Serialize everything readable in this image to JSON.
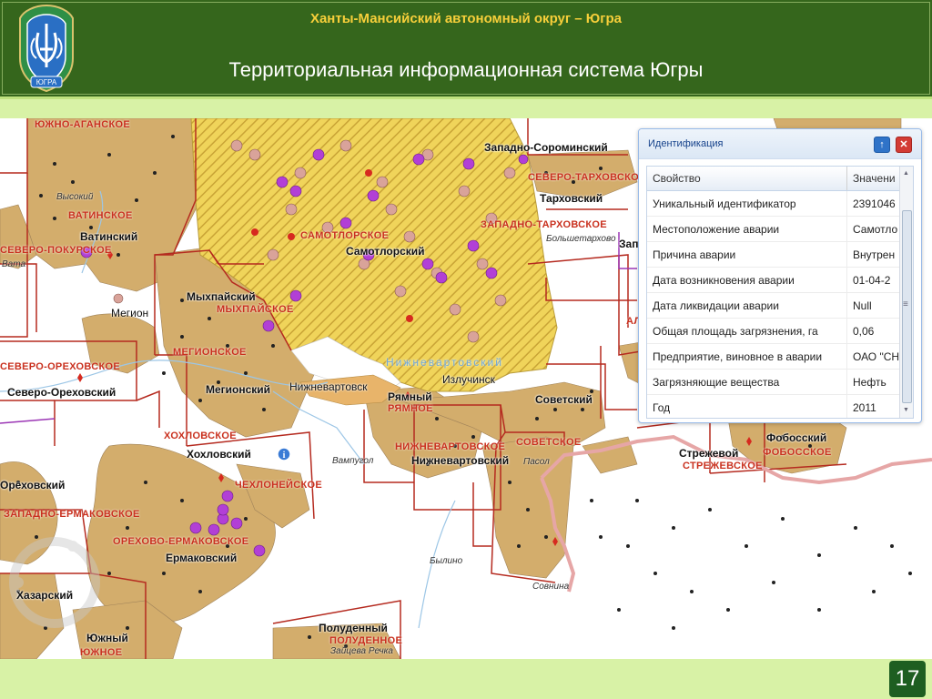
{
  "header": {
    "subtitle": "Ханты-Мансийский автономный округ – Югра",
    "title": "Территориальная информационная система Югры",
    "logo_text": "ЮГРА"
  },
  "map": {
    "places": [
      {
        "id": "vatinsky",
        "text": "Ватинский"
      },
      {
        "id": "megion",
        "text": "Мегион"
      },
      {
        "id": "myhpaysky",
        "text": "Мыхпайский"
      },
      {
        "id": "samotlorsky",
        "text": "Самотлорский"
      },
      {
        "id": "nizhnevartovsk-city",
        "text": "Нижневартовск"
      },
      {
        "id": "severo-orekhovsky",
        "text": "Северо-Ореховский"
      },
      {
        "id": "megionsky",
        "text": "Мегионский"
      },
      {
        "id": "ryamny",
        "text": "Рямный"
      },
      {
        "id": "izluchinsk",
        "text": "Излучинск"
      },
      {
        "id": "sovetsky",
        "text": "Советский"
      },
      {
        "id": "nizhnevartovsky",
        "text": "Нижневартовский"
      },
      {
        "id": "khokhlovsky",
        "text": "Хохловский"
      },
      {
        "id": "orekhovsky",
        "text": "Ореховский"
      },
      {
        "id": "ermakovsky",
        "text": "Ермаковский"
      },
      {
        "id": "khazarsky",
        "text": "Хазарский"
      },
      {
        "id": "yuzhny",
        "text": "Южный"
      },
      {
        "id": "poludenny",
        "text": "Полуденный"
      },
      {
        "id": "strezhevoy",
        "text": "Стрежевой"
      },
      {
        "id": "fobossky",
        "text": "Фобосский"
      },
      {
        "id": "tarkhovsky",
        "text": "Тарховский"
      },
      {
        "id": "zapadno-sorominsky",
        "text": "Западно-Сороминский"
      }
    ],
    "fields": [
      {
        "id": "yuzhno-aganskoe",
        "text": "ЮЖНО-АГАНСКОЕ"
      },
      {
        "id": "vatinskoe",
        "text": "ВАТИНСКОЕ"
      },
      {
        "id": "severo-pokurskoe",
        "text": "СЕВЕРО-ПОКУРСКОЕ"
      },
      {
        "id": "samotlorskoe",
        "text": "САМОТЛОРСКОЕ"
      },
      {
        "id": "myhpayskoe",
        "text": "МЫХПАЙСКОЕ"
      },
      {
        "id": "megionskoe",
        "text": "МЕГИОНСКОЕ"
      },
      {
        "id": "severo-orekhovskoe",
        "text": "СЕВЕРО-ОРЕХОВСКОЕ"
      },
      {
        "id": "khokhlovskoe",
        "text": "ХОХЛОВСКОЕ"
      },
      {
        "id": "chekhloneyskoe",
        "text": "ЧЕХЛОНЕЙСКОЕ"
      },
      {
        "id": "zapadno-ermakovskoe",
        "text": "ЗАПАДНО-ЕРМАКОВСКОЕ"
      },
      {
        "id": "orekhovo-ermakovskoe",
        "text": "ОРЕХОВО-ЕРМАКОВСКОЕ"
      },
      {
        "id": "ryamnoe",
        "text": "РЯМНОЕ"
      },
      {
        "id": "nizhnevartovskoe",
        "text": "НИЖНЕВАРТОВСКОЕ"
      },
      {
        "id": "sovetskoe",
        "text": "СОВЕТСКОЕ"
      },
      {
        "id": "yuzhnoe",
        "text": "ЮЖНОЕ"
      },
      {
        "id": "poludennoe",
        "text": "ПОЛУДЕННОЕ"
      },
      {
        "id": "strezhevskoe",
        "text": "СТРЕЖЕВСКОЕ"
      },
      {
        "id": "fobosskoe",
        "text": "ФОБОССКОЕ"
      },
      {
        "id": "zapadno-tarkhovskoe",
        "text": "ЗАПАДНО-ТАРХОВСКОЕ"
      },
      {
        "id": "severo-tarkhovskoe",
        "text": "СЕВЕРО-ТАРХОВСКОЕ"
      }
    ],
    "rivers": [
      {
        "id": "vysokiy",
        "text": "Высокий"
      },
      {
        "id": "vata",
        "text": "Вата"
      },
      {
        "id": "vampugol",
        "text": "Вампугол"
      },
      {
        "id": "pasol",
        "text": "Пасол"
      },
      {
        "id": "bylino",
        "text": "Былино"
      },
      {
        "id": "sovnina",
        "text": "Совнина"
      },
      {
        "id": "bolshetarkhovo",
        "text": "Большетархово"
      },
      {
        "id": "zaitseva-rechka",
        "text": "Зайцева Речка"
      }
    ],
    "region_label": "Нижневартовский",
    "edge_labels": {
      "zap": "Зап",
      "al": "АЛ"
    },
    "colors": {
      "field_fill": "#d3ad6c",
      "field_boundary": "#b52a1f",
      "hatched_zone": "#f0d45a",
      "incident_marker": "#b23fd6",
      "incident_marker_alt": "#d9a39a",
      "region_border": "#e6a6a6"
    }
  },
  "panel": {
    "title": "Идентификация",
    "up_icon": "↑",
    "close_icon": "✕",
    "columns": [
      "Свойство",
      "Значени"
    ],
    "rows": [
      [
        "Уникальный идентификатор",
        "2391046"
      ],
      [
        "Местоположение аварии",
        "Самотло"
      ],
      [
        "Причина аварии",
        "Внутрен"
      ],
      [
        "Дата возникновения аварии",
        "01-04-2"
      ],
      [
        "Дата ликвидации аварии",
        "Null"
      ],
      [
        "Общая площадь загрязнения, га",
        "0,06"
      ],
      [
        "Предприятие, виновное в аварии",
        "ОАО \"СН"
      ],
      [
        "Загрязняющие вещества",
        "Нефть"
      ],
      [
        "Год",
        "2011"
      ]
    ],
    "scroll_grip": "≡"
  },
  "footer": {
    "page_number": "17"
  }
}
